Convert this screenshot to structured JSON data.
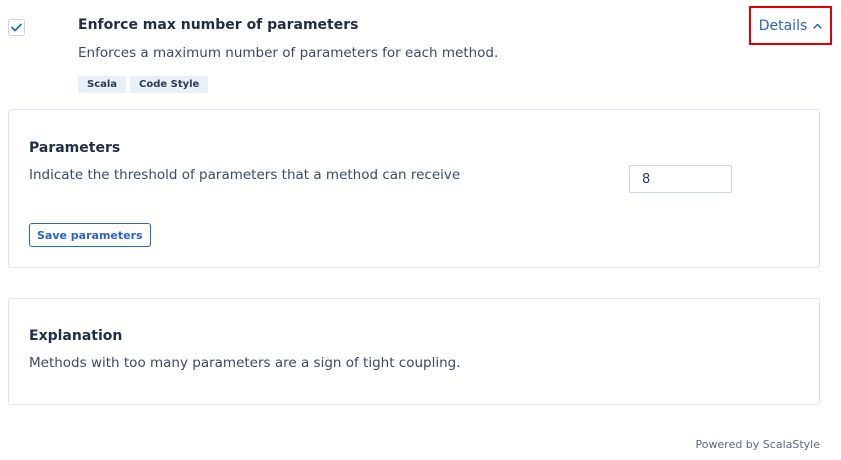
{
  "rule": {
    "checked": true,
    "title": "Enforce max number of parameters",
    "description": "Enforces a maximum number of parameters for each method.",
    "tags": [
      "Scala",
      "Code Style"
    ],
    "details_label": "Details"
  },
  "parameters": {
    "heading": "Parameters",
    "prompt": "Indicate the threshold of parameters that a method can receive",
    "value": "8",
    "save_label": "Save parameters"
  },
  "explanation": {
    "heading": "Explanation",
    "text": "Methods with too many parameters are a sign of tight coupling."
  },
  "footer": {
    "powered_by": "Powered by ScalaStyle"
  },
  "colors": {
    "accent": "#2a63c9",
    "highlight_border": "#e00000",
    "tag_background": "#eaf0f8"
  }
}
